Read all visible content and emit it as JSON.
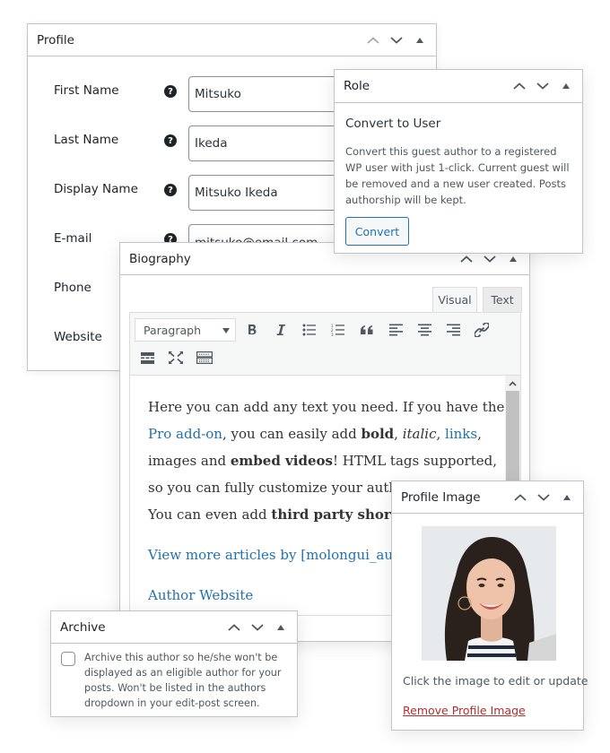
{
  "profile": {
    "title": "Profile",
    "fields": [
      {
        "label": "First Name",
        "value": "Mitsuko"
      },
      {
        "label": "Last Name",
        "value": "Ikeda"
      },
      {
        "label": "Display Name",
        "value": "Mitsuko Ikeda"
      },
      {
        "label": "E-mail",
        "value": "mitsuko@email.com"
      },
      {
        "label": "Phone",
        "value": ""
      },
      {
        "label": "Website",
        "value": ""
      }
    ],
    "help_glyph": "?"
  },
  "role": {
    "title": "Role",
    "subtitle": "Convert to User",
    "description": "Convert this guest author to a registered WP user with just 1-click. Current guest will be removed and a new user created. Posts authorship will be kept.",
    "button_label": "Convert"
  },
  "biography": {
    "title": "Biography",
    "tabs": [
      {
        "label": "Visual",
        "active": true
      },
      {
        "label": "Text",
        "active": false
      }
    ],
    "format_select": "Paragraph",
    "toolbar_icons": [
      "bold-icon",
      "italic-icon",
      "bulleted-list-icon",
      "numbered-list-icon",
      "blockquote-icon",
      "align-left-icon",
      "align-center-icon",
      "align-right-icon",
      "link-icon",
      "read-more-icon",
      "fullscreen-icon",
      "keyboard-icon"
    ],
    "content": {
      "p1": {
        "t1": "Here you can add any text you need. If you have the ",
        "link1": "Pro add-on",
        "t2": ", you can easily add ",
        "bold": "bold",
        "t3": ", ",
        "italic": "italic",
        "t4": ", ",
        "link2": "links",
        "t5": ",",
        "t6": "images and ",
        "bold2": "embed videos",
        "t7": "! HTML tags supported,",
        "t8": "so you can fully customize your author",
        "t9": "You can even add ",
        "bold3": "third party shortc"
      },
      "link_more": "View more articles by [molongui_auth",
      "link_website": "Author Website"
    }
  },
  "profile_image": {
    "title": "Profile Image",
    "hint": "Click the image to edit or update",
    "remove_label": "Remove Profile Image"
  },
  "archive": {
    "title": "Archive",
    "checked": false,
    "description": "Archive this author so he/she won't be displayed as an eligible author for your posts. Won't be listed in the authors dropdown in your edit-post screen."
  },
  "colors": {
    "link": "#2271b1",
    "danger": "#b32d2e",
    "border": "#c3c4c7"
  }
}
